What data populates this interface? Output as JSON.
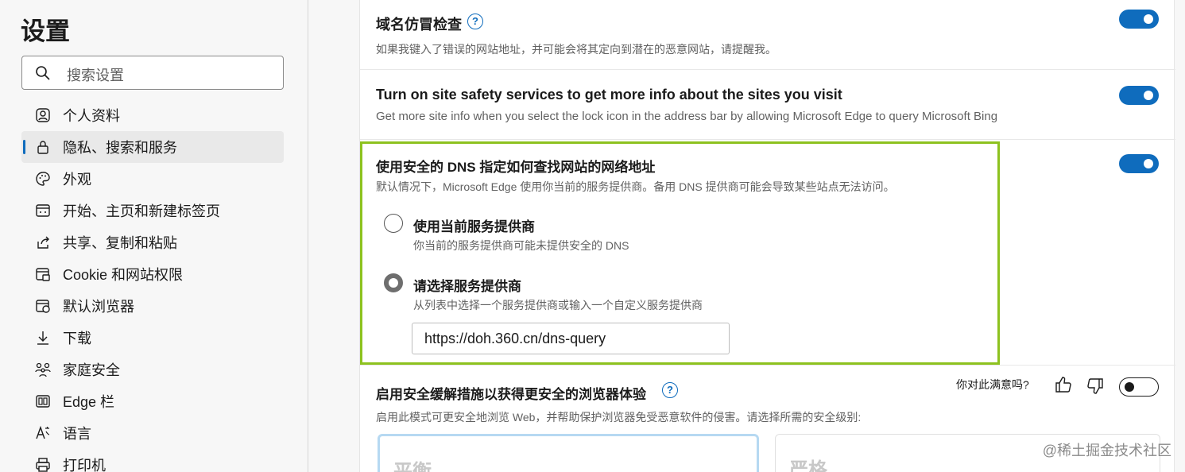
{
  "sidebar": {
    "title": "设置",
    "search_placeholder": "搜索设置",
    "items": [
      {
        "label": "个人资料",
        "icon": "profile-icon"
      },
      {
        "label": "隐私、搜索和服务",
        "icon": "lock-icon",
        "active": true
      },
      {
        "label": "外观",
        "icon": "palette-icon"
      },
      {
        "label": "开始、主页和新建标签页",
        "icon": "home-tab-icon"
      },
      {
        "label": "共享、复制和粘贴",
        "icon": "share-icon"
      },
      {
        "label": "Cookie 和网站权限",
        "icon": "site-permissions-icon"
      },
      {
        "label": "默认浏览器",
        "icon": "browser-icon"
      },
      {
        "label": "下载",
        "icon": "download-icon"
      },
      {
        "label": "家庭安全",
        "icon": "family-icon"
      },
      {
        "label": "Edge 栏",
        "icon": "edge-bar-icon"
      },
      {
        "label": "语言",
        "icon": "language-icon"
      },
      {
        "label": "打印机",
        "icon": "printer-icon"
      }
    ]
  },
  "settings": {
    "typo": {
      "title": "域名仿冒检查",
      "desc": "如果我键入了错误的网站地址，并可能会将其定向到潜在的恶意网站，请提醒我。",
      "enabled": true
    },
    "safety": {
      "title": "Turn on site safety services to get more info about the sites you visit",
      "desc": "Get more site info when you select the lock icon in the address bar by allowing Microsoft Edge to query Microsoft Bing",
      "enabled": true
    },
    "dns": {
      "title": "使用安全的 DNS 指定如何查找网站的网络地址",
      "desc": "默认情况下，Microsoft Edge 使用你当前的服务提供商。备用 DNS 提供商可能会导致某些站点无法访问。",
      "enabled": true,
      "option_current": {
        "label": "使用当前服务提供商",
        "desc": "你当前的服务提供商可能未提供安全的 DNS",
        "selected": false
      },
      "option_choose": {
        "label": "请选择服务提供商",
        "desc": "从列表中选择一个服务提供商或输入一个自定义服务提供商",
        "selected": true
      },
      "provider_value": "https://doh.360.cn/dns-query"
    },
    "enhanced": {
      "title": "启用安全缓解措施以获得更安全的浏览器体验",
      "desc": "启用此模式可更安全地浏览 Web，并帮助保护浏览器免受恶意软件的侵害。请选择所需的安全级别:",
      "feedback": "你对此满意吗?",
      "enabled": false,
      "levels": [
        "平衡",
        "严格"
      ]
    }
  },
  "watermark": "@稀土掘金技术社区",
  "colors": {
    "accent": "#0f6cbd",
    "highlight_border": "#8dc21f"
  }
}
